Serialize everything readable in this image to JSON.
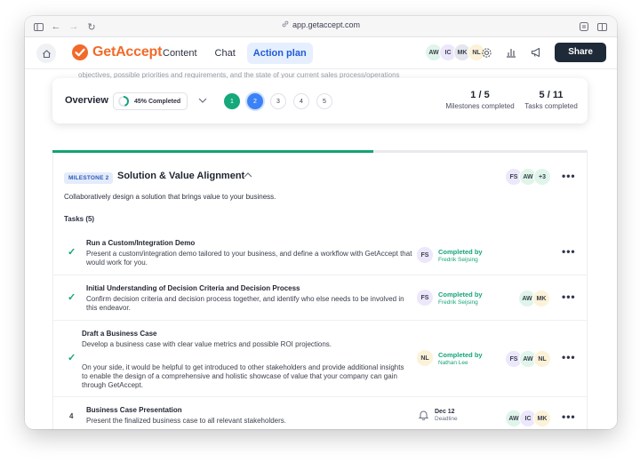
{
  "browser": {
    "url": "app.getaccept.com"
  },
  "header": {
    "logo_text": "GetAccept",
    "tabs": [
      {
        "label": "Content",
        "active": false
      },
      {
        "label": "Chat",
        "active": false
      },
      {
        "label": "Action plan",
        "active": true
      }
    ],
    "avatars": [
      "AW",
      "IC",
      "MK",
      "NL"
    ],
    "share_label": "Share"
  },
  "faded_text": "objectives, possible priorities and requirements, and the state of your current sales process/operations",
  "overview": {
    "title": "Overview",
    "completed_label": "45% Completed",
    "completed_fraction": 0.45,
    "steps": [
      "1",
      "2",
      "3",
      "4",
      "5"
    ],
    "milestones_value": "1 / 5",
    "milestones_label": "Milestones completed",
    "tasks_value": "5 / 11",
    "tasks_label": "Tasks completed"
  },
  "progress_fraction": 0.6,
  "milestone": {
    "badge": "MILESTONE 2",
    "title": "Solution & Value Alignment",
    "avatars": [
      "FS",
      "AW",
      "+3"
    ],
    "description": "Collaboratively design a solution that brings value to your business.",
    "tasks_heading": "Tasks (5)",
    "tasks": [
      {
        "title": "Run a Custom/Integration Demo",
        "desc": "Present a custom/integration demo tailored to your business, and define a workflow with GetAccept that would work for you.",
        "done_initials": "FS",
        "done_label": "Completed by",
        "done_name": "Fredrik Seijsing",
        "assignees": []
      },
      {
        "title": "Initial Understanding of Decision Criteria and Decision Process",
        "desc": "Confirm decision criteria and decision process together, and identify who else needs to be involved in this endeavor.",
        "done_initials": "FS",
        "done_label": "Completed by",
        "done_name": "Fredrik Seijsing",
        "assignees": [
          "AW",
          "MK"
        ]
      },
      {
        "title": "Draft a Business Case",
        "desc": "Develop a business case with clear value metrics and possible ROI projections.",
        "desc2": "On your side, it would be helpful to get introduced to other stakeholders and provide additional insights to enable the design of a comprehensive and holistic showcase of value that your company can gain through GetAccept.",
        "done_initials": "NL",
        "done_label": "Completed by",
        "done_name": "Nathan Lee",
        "assignees": [
          "FS",
          "AW",
          "NL"
        ]
      },
      {
        "number": "4",
        "title": "Business Case Presentation",
        "desc": "Present the finalized business case to all relevant stakeholders.",
        "deadline_date": "Dec 12",
        "deadline_label": "Deadline",
        "assignees": [
          "AW",
          "IC",
          "MK"
        ]
      }
    ]
  }
}
